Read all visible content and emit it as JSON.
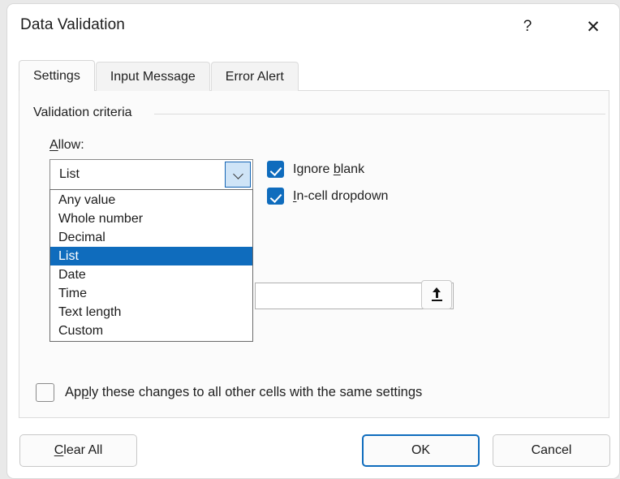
{
  "window": {
    "title": "Data Validation",
    "help_icon": "question-mark-icon",
    "close_icon": "close-icon"
  },
  "tabs": [
    {
      "label": "Settings",
      "active": true
    },
    {
      "label": "Input Message",
      "active": false
    },
    {
      "label": "Error Alert",
      "active": false
    }
  ],
  "settings": {
    "group_label": "Validation criteria",
    "allow_label_pre": "A",
    "allow_label_post": "llow:",
    "combo": {
      "value": "List",
      "arrow_icon": "chevron-down-icon",
      "expanded": true,
      "options": [
        "Any value",
        "Whole number",
        "Decimal",
        "List",
        "Date",
        "Time",
        "Text length",
        "Custom"
      ],
      "selected_option": "List"
    },
    "ignore_blank": {
      "label_pre": "Ignore ",
      "label_key": "b",
      "label_post": "lank",
      "checked": true
    },
    "in_cell_dropdown": {
      "label_pre": "",
      "label_key": "I",
      "label_post": "n-cell dropdown",
      "checked": true
    },
    "source_field": {
      "value": "",
      "picker_icon": "range-select-icon"
    },
    "apply_all": {
      "label_pre": "Ap",
      "label_key": "p",
      "label_post": "ly these changes to all other cells with the same settings",
      "checked": false
    }
  },
  "footer": {
    "clear_all_pre": "C",
    "clear_all_post": "lear All",
    "ok": "OK",
    "cancel": "Cancel"
  },
  "colors": {
    "accent": "#0f6cbd",
    "selection": "#0f6cbd",
    "panel_bg": "#fbfbfb",
    "window_bg": "#ffffff"
  }
}
